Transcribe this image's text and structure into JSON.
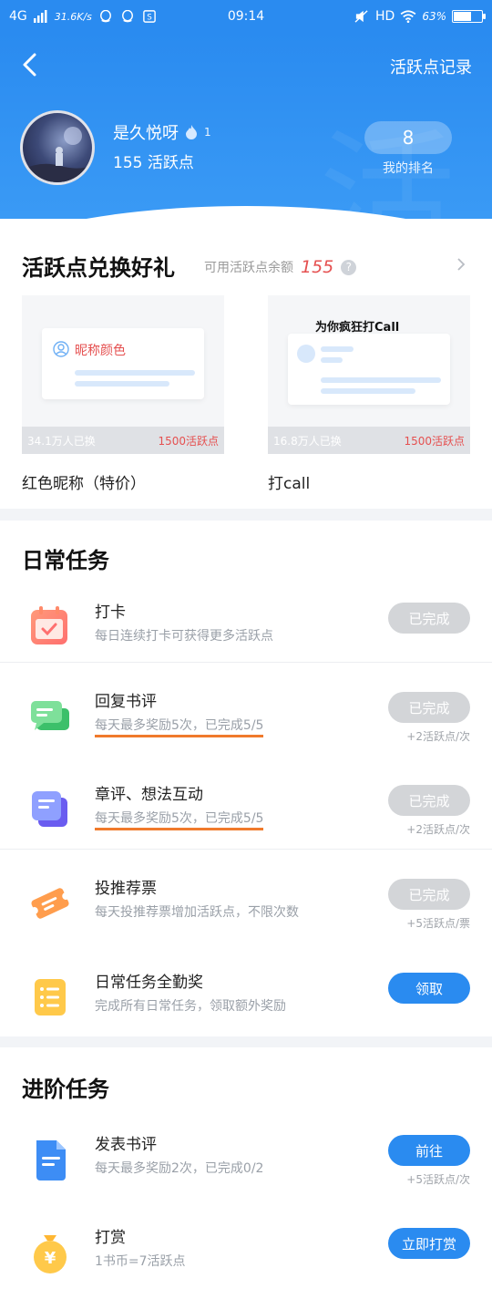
{
  "status_bar": {
    "network": "4G",
    "speed": "31.6K/s",
    "time": "09:14",
    "hd": "HD",
    "battery": "63%",
    "battery_level": 0.63
  },
  "header": {
    "record_link": "活跃点记录",
    "username": "是久悦呀",
    "level": "1",
    "points_text": "155 活跃点",
    "rank_value": "8",
    "rank_label": "我的排名"
  },
  "exchange": {
    "title": "活跃点兑换好礼",
    "balance_label": "可用活跃点余额",
    "balance_value": "155",
    "gifts": [
      {
        "name": "红色昵称（特价）",
        "count": "34.1万人已换",
        "cost": "1500活跃点",
        "preview_label": "昵称颜色"
      },
      {
        "name": "打call",
        "count": "16.8万人已换",
        "cost": "1500活跃点",
        "preview_label": "为你疯狂打Call"
      }
    ]
  },
  "daily": {
    "title": "日常任务",
    "tasks": [
      {
        "title": "打卡",
        "desc": "每日连续打卡可获得更多活跃点",
        "button": "已完成",
        "reward": ""
      },
      {
        "title": "回复书评",
        "desc": "每天最多奖励5次，已完成5/5",
        "button": "已完成",
        "reward": "+2活跃点/次"
      },
      {
        "title": "章评、想法互动",
        "desc": "每天最多奖励5次，已完成5/5",
        "button": "已完成",
        "reward": "+2活跃点/次"
      },
      {
        "title": "投推荐票",
        "desc": "每天投推荐票增加活跃点，不限次数",
        "button": "已完成",
        "reward": "+5活跃点/票"
      },
      {
        "title": "日常任务全勤奖",
        "desc": "完成所有日常任务，领取额外奖励",
        "button": "领取",
        "reward": ""
      }
    ]
  },
  "advanced": {
    "title": "进阶任务",
    "tasks": [
      {
        "title": "发表书评",
        "desc": "每天最多奖励2次，已完成0/2",
        "button": "前往",
        "reward": "+5活跃点/次"
      },
      {
        "title": "打赏",
        "desc": "1书币=7活跃点",
        "button": "立即打赏",
        "reward": ""
      }
    ]
  },
  "colors": {
    "primary": "#2a8bf0",
    "accent_red": "#e55050",
    "done_gray": "#d3d5d8",
    "underline_orange": "#f07a2c"
  },
  "icons": [
    "signal-icon",
    "qq-icon",
    "s-icon",
    "mute-icon",
    "wifi-icon",
    "battery-icon",
    "back-icon",
    "flame-icon",
    "help-icon",
    "chevron-right-icon",
    "calendar-icon",
    "chat-icon",
    "note-icon",
    "ticket-icon",
    "list-icon",
    "doc-icon",
    "coin-icon"
  ]
}
